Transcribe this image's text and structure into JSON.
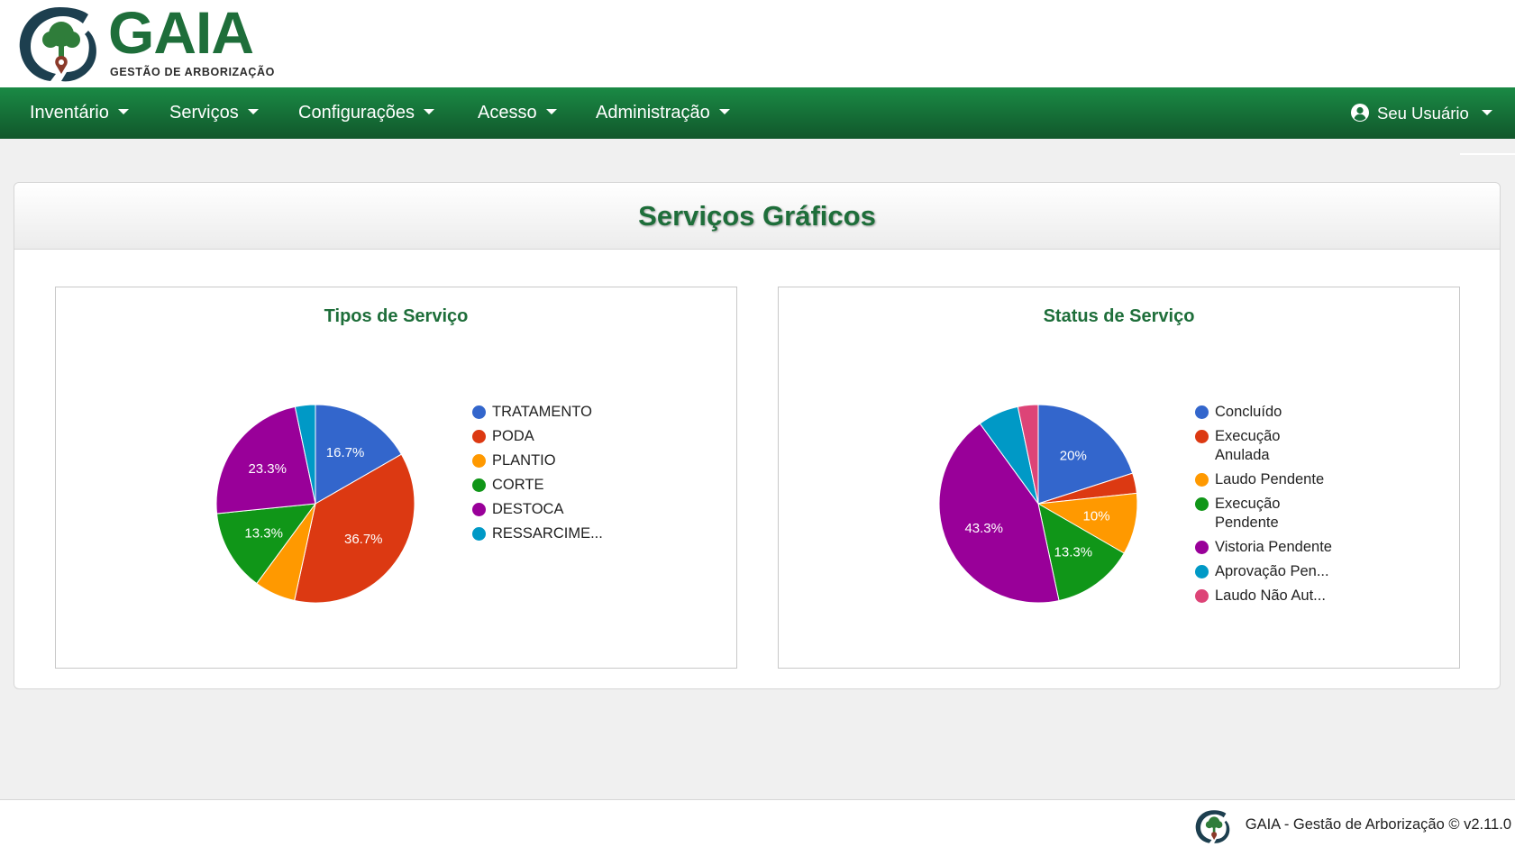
{
  "brand": {
    "name": "GAIA",
    "subtitle": "GESTÃO DE ARBORIZAÇÃO",
    "colors": {
      "green": "#1e6e3a",
      "nav_top": "#1a8a45",
      "nav_bottom": "#11572b"
    }
  },
  "nav": {
    "items": [
      {
        "label": "Inventário"
      },
      {
        "label": "Serviços"
      },
      {
        "label": "Configurações"
      },
      {
        "label": "Acesso"
      },
      {
        "label": "Administração"
      }
    ],
    "user": {
      "label": "Seu Usuário",
      "icon": "user-circle-icon"
    }
  },
  "page": {
    "title": "Serviços Gráficos"
  },
  "charts": [
    {
      "title": "Tipos de Serviço",
      "legend": [
        "TRATAMENTO",
        "PODA",
        "PLANTIO",
        "CORTE",
        "DESTOCA",
        "RESSARCIME..."
      ]
    },
    {
      "title": "Status de Serviço",
      "legend": [
        "Concluído",
        "Execução Anulada",
        "Laudo Pendente",
        "Execução Pendente",
        "Vistoria Pendente",
        "Aprovação Pen...",
        "Laudo Não Aut..."
      ]
    }
  ],
  "chart_data": [
    {
      "type": "pie",
      "title": "Tipos de Serviço",
      "categories": [
        "TRATAMENTO",
        "PODA",
        "PLANTIO",
        "CORTE",
        "DESTOCA",
        "RESSARCIME..."
      ],
      "values": [
        16.7,
        36.7,
        6.7,
        13.3,
        23.3,
        3.3
      ],
      "labels": [
        "16.7%",
        "36.7%",
        "",
        "13.3%",
        "23.3%",
        ""
      ],
      "colors": [
        "#3366cc",
        "#dc3912",
        "#ff9900",
        "#109618",
        "#990099",
        "#0099c6"
      ],
      "legend_position": "right"
    },
    {
      "type": "pie",
      "title": "Status de Serviço",
      "categories": [
        "Concluído",
        "Execução Anulada",
        "Laudo Pendente",
        "Execução Pendente",
        "Vistoria Pendente",
        "Aprovação Pen...",
        "Laudo Não Aut..."
      ],
      "values": [
        20,
        3.3,
        10,
        13.3,
        43.3,
        6.7,
        3.3
      ],
      "labels": [
        "20%",
        "",
        "10%",
        "13.3%",
        "43.3%",
        "",
        ""
      ],
      "colors": [
        "#3366cc",
        "#dc3912",
        "#ff9900",
        "#109618",
        "#990099",
        "#0099c6",
        "#dd4477"
      ],
      "legend_position": "right"
    }
  ],
  "footer": {
    "text": "GAIA - Gestão de Arborização © v2.11.0"
  }
}
